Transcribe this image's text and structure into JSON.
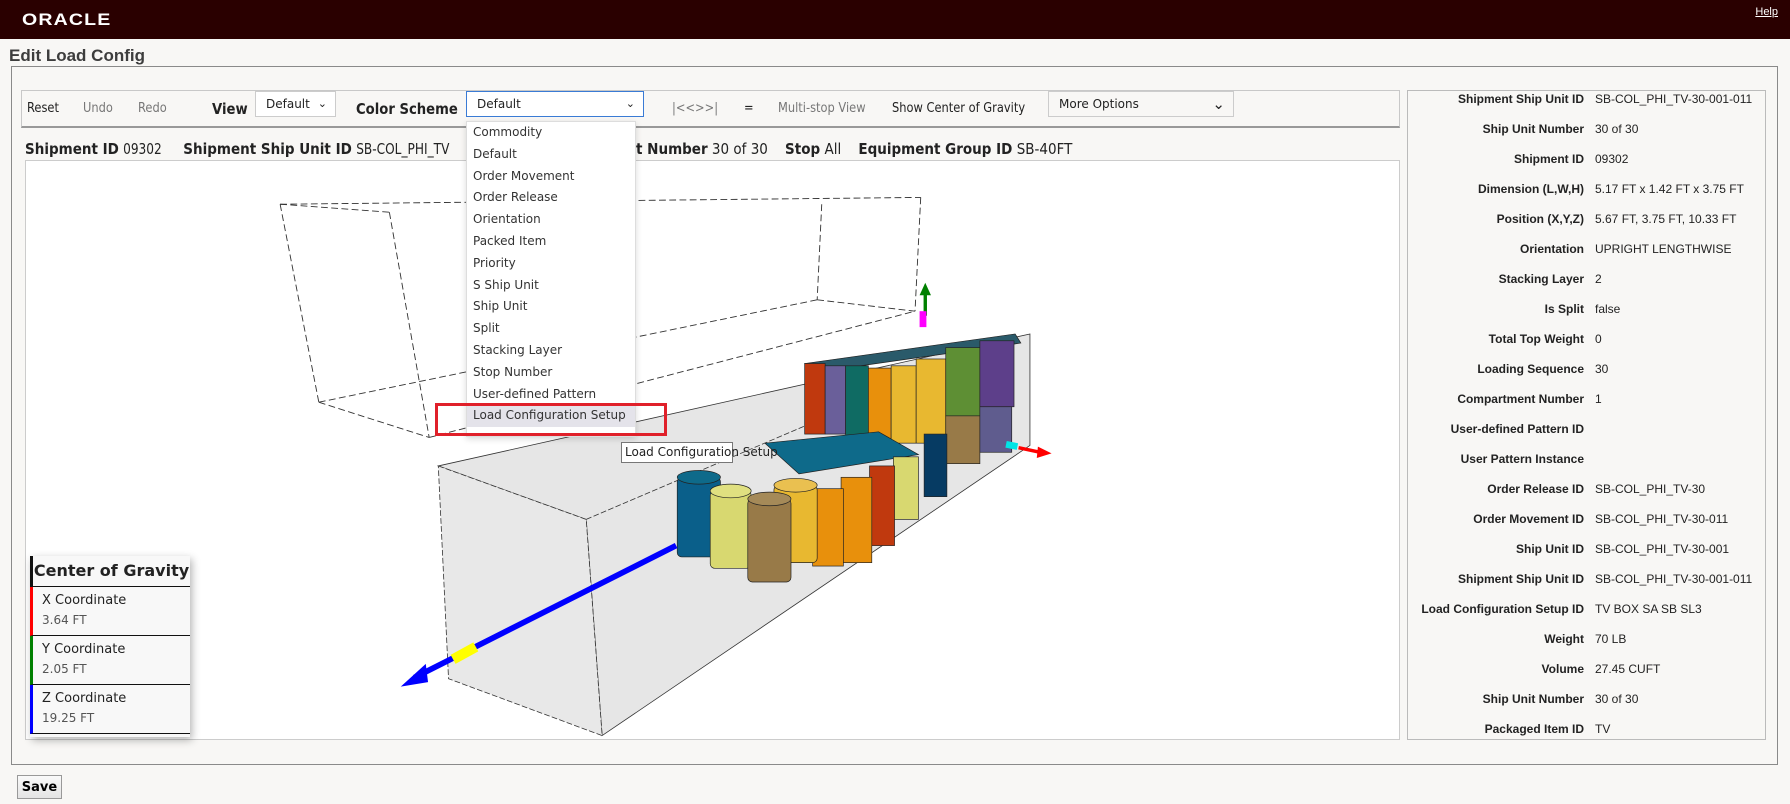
{
  "header": {
    "logo": "ORACLE",
    "help": "Help"
  },
  "page_title": "Edit Load Config",
  "toolbar": {
    "reset": "Reset",
    "undo": "Undo",
    "redo": "Redo",
    "view_label": "View",
    "view_value": "Default",
    "color_scheme_label": "Color Scheme",
    "color_scheme_value": "Default",
    "nav": "|<<>>|",
    "equals": "=",
    "multi_stop": "Multi-stop View",
    "show_cog": "Show Center of Gravity",
    "more_options": "More Options"
  },
  "info": {
    "shipment_id_label": "Shipment ID",
    "shipment_id": "09302",
    "ssu_label": "Shipment Ship Unit ID",
    "ssu": "SB-COL_PHI_TV",
    "su_number_label": "t Number",
    "su_number": "30 of 30",
    "stop_label": "Stop",
    "stop": "All",
    "equip_label": "Equipment Group ID",
    "equip": "SB-40FT"
  },
  "color_scheme_options": [
    "Commodity",
    "Default",
    "Order Movement",
    "Order Release",
    "Orientation",
    "Packed Item",
    "Priority",
    "S Ship Unit",
    "Ship Unit",
    "Split",
    "Stacking Layer",
    "Stop Number",
    "User-defined Pattern",
    "Load Configuration Setup"
  ],
  "highlighted_option": "Load Configuration Setup",
  "tooltip": "Load Configuration Setup",
  "center_of_gravity": {
    "title": "Center of Gravity",
    "rows": [
      {
        "label": "X Coordinate",
        "value": "3.64 FT",
        "color": "#ff0000"
      },
      {
        "label": "Y Coordinate",
        "value": "2.05 FT",
        "color": "#008000"
      },
      {
        "label": "Z Coordinate",
        "value": "19.25 FT",
        "color": "#0000ff"
      }
    ]
  },
  "details": [
    {
      "label": "Shipment Ship Unit ID",
      "value": "SB-COL_PHI_TV-30-001-011"
    },
    {
      "label": "Ship Unit Number",
      "value": "30 of 30"
    },
    {
      "label": "Shipment ID",
      "value": "09302"
    },
    {
      "label": "Dimension (L,W,H)",
      "value": "5.17 FT x 1.42 FT x 3.75 FT"
    },
    {
      "label": "Position (X,Y,Z)",
      "value": "5.67 FT, 3.75 FT, 10.33 FT"
    },
    {
      "label": "Orientation",
      "value": "UPRIGHT LENGTHWISE"
    },
    {
      "label": "Stacking Layer",
      "value": "2"
    },
    {
      "label": "Is Split",
      "value": "false"
    },
    {
      "label": "Total Top Weight",
      "value": "0"
    },
    {
      "label": "Loading Sequence",
      "value": "30"
    },
    {
      "label": "Compartment Number",
      "value": "1"
    },
    {
      "label": "User-defined Pattern ID",
      "value": ""
    },
    {
      "label": "User Pattern Instance",
      "value": ""
    },
    {
      "label": "Order Release ID",
      "value": "SB-COL_PHI_TV-30"
    },
    {
      "label": "Order Movement ID",
      "value": "SB-COL_PHI_TV-30-011"
    },
    {
      "label": "Ship Unit ID",
      "value": "SB-COL_PHI_TV-30-001"
    },
    {
      "label": "Shipment Ship Unit ID",
      "value": "SB-COL_PHI_TV-30-001-011"
    },
    {
      "label": "Load Configuration Setup ID",
      "value": "TV BOX SA SB SL3"
    },
    {
      "label": "Weight",
      "value": "70 LB"
    },
    {
      "label": "Volume",
      "value": "27.45 CUFT"
    },
    {
      "label": "Ship Unit Number",
      "value": "30 of 30"
    },
    {
      "label": "Packaged Item ID",
      "value": "TV"
    }
  ],
  "save": "Save",
  "colors": {
    "header_bg": "#2a0000",
    "highlight_box": "#e0202a",
    "axis_x": "#ff0000",
    "axis_y": "#008000",
    "axis_z": "#0000ff"
  }
}
